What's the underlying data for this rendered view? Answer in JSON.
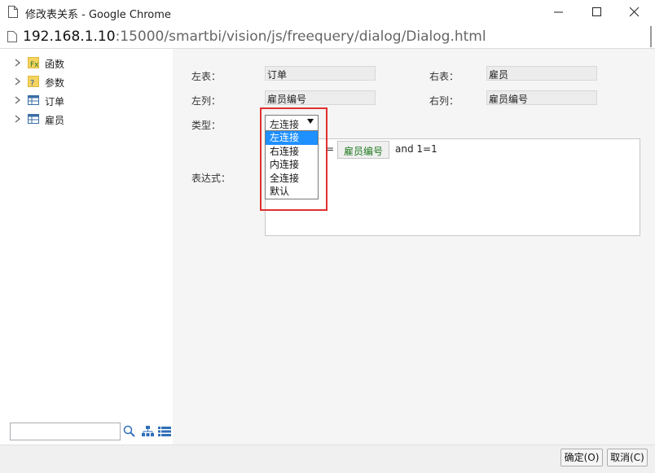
{
  "window": {
    "title": "修改表关系 - Google Chrome"
  },
  "address": {
    "host": "192.168.1.10",
    "rest": ":15000/smartbi/vision/js/freequery/dialog/Dialog.html"
  },
  "tree": {
    "items": [
      {
        "label": "函数",
        "icon": "function-icon"
      },
      {
        "label": "参数",
        "icon": "parameter-icon"
      },
      {
        "label": "订单",
        "icon": "table-icon"
      },
      {
        "label": "雇员",
        "icon": "table-icon"
      }
    ],
    "search_value": ""
  },
  "form": {
    "left_table_label": "左表：",
    "left_table_value": "订单",
    "right_table_label": "右表：",
    "right_table_value": "雇员",
    "left_column_label": "左列：",
    "left_column_value": "雇员编号",
    "right_column_label": "右列：",
    "right_column_value": "雇员编号",
    "type_label": "类型：",
    "type_value": "左连接",
    "expression_label": "表达式：",
    "expression": {
      "eq": "=",
      "chip": "雇员编号",
      "tail": "and 1=1"
    }
  },
  "dropdown": {
    "options": [
      "左连接",
      "右连接",
      "内连接",
      "全连接",
      "默认"
    ],
    "selected_index": 0
  },
  "footer": {
    "ok_label": "确定(O)",
    "cancel_label": "取消(C)"
  },
  "colors": {
    "highlight": "#e03030",
    "selection": "#1e90ff",
    "chip_text": "#1f7a1f"
  }
}
